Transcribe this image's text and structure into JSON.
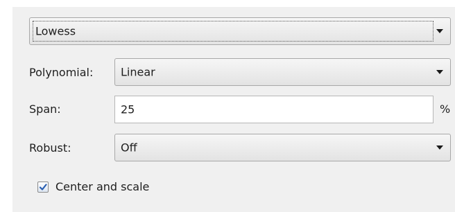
{
  "method": {
    "selected": "Lowess"
  },
  "polynomial": {
    "label": "Polynomial:",
    "selected": "Linear"
  },
  "span": {
    "label": "Span:",
    "value": "25",
    "unit": "%"
  },
  "robust": {
    "label": "Robust:",
    "selected": "Off"
  },
  "center_scale": {
    "label": "Center and scale",
    "checked": true
  },
  "icons": {
    "dropdown_arrow": "chevron-down-icon",
    "checkbox_mark": "checkmark-icon"
  },
  "colors": {
    "panel_bg": "#f0f0f0",
    "checkmark": "#2a5fb0"
  }
}
